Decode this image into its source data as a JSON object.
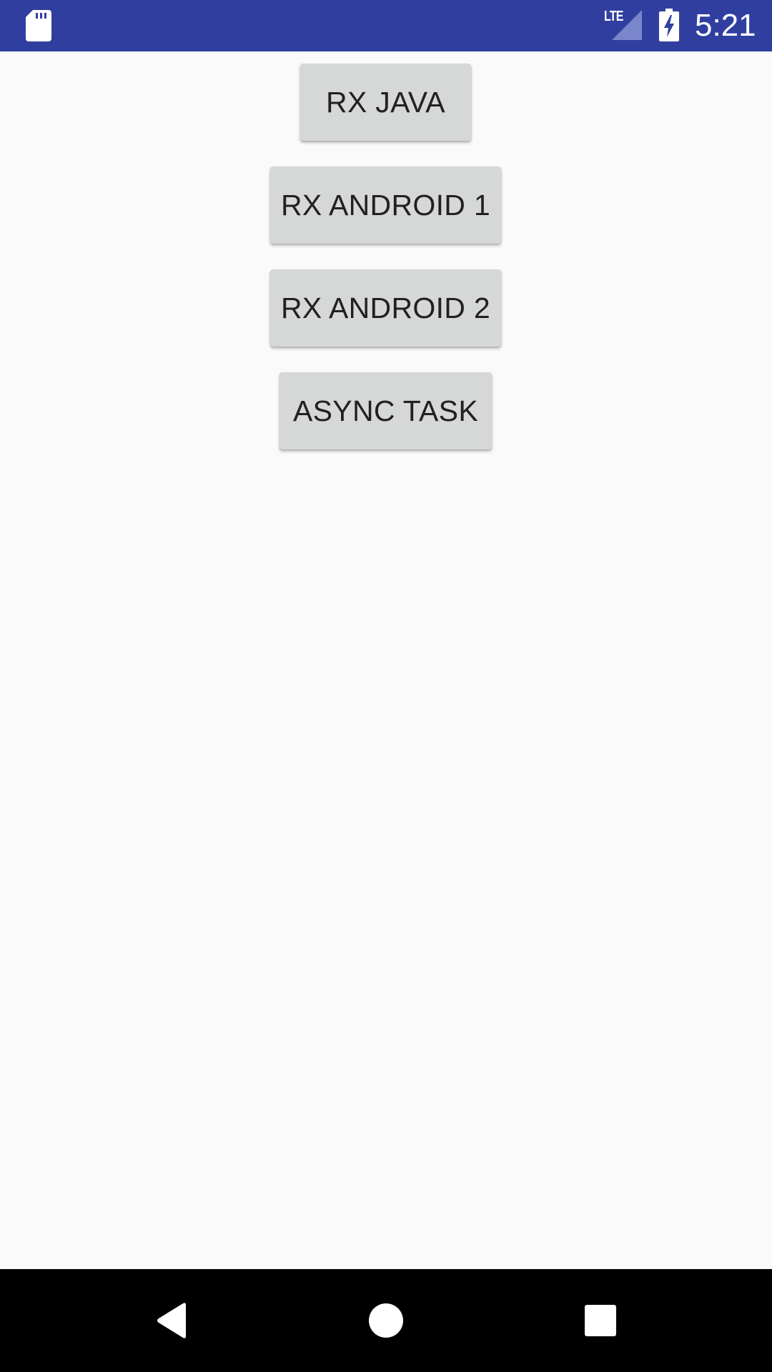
{
  "status_bar": {
    "time": "5:21",
    "network_label": "LTE",
    "icons": [
      "sd-card-icon",
      "lte-signal-icon",
      "battery-charging-icon"
    ],
    "background_color": "#303f9f"
  },
  "buttons": [
    {
      "label": "RX JAVA"
    },
    {
      "label": "RX ANDROID 1"
    },
    {
      "label": "RX ANDROID 2"
    },
    {
      "label": "ASYNC TASK"
    }
  ],
  "nav_bar": {
    "icons": [
      "back-icon",
      "home-icon",
      "recents-icon"
    ]
  }
}
